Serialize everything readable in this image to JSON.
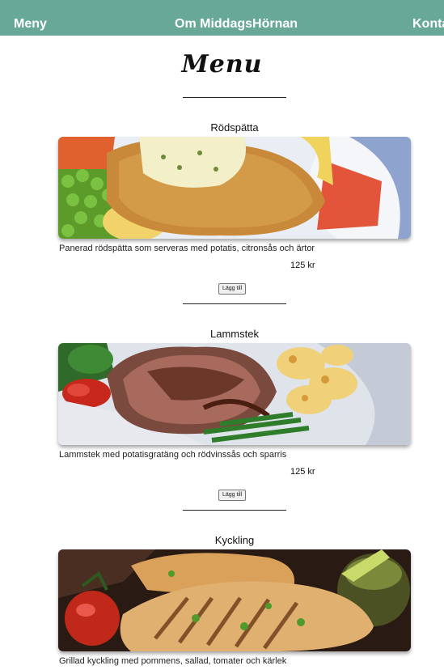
{
  "nav": {
    "links": [
      "Meny",
      "Om MiddagsHörnan",
      "Kontakt"
    ]
  },
  "page": {
    "heading": "Menu"
  },
  "dishes": [
    {
      "title": "Rödspätta",
      "description": "Panerad rödspätta som serveras med potatis, citronsås och ärtor",
      "price": "125 kr",
      "button": "Lägg till"
    },
    {
      "title": "Lammstek",
      "description": "Lammstek med potatisgratäng och rödvinssås och sparris",
      "price": "125 kr",
      "button": "Lägg till"
    },
    {
      "title": "Kyckling",
      "description": "Grillad kyckling med pommens, sallad, tomater och kärlek"
    }
  ],
  "colors": {
    "navbar": "#67a996",
    "nav_text": "#ffffff"
  }
}
